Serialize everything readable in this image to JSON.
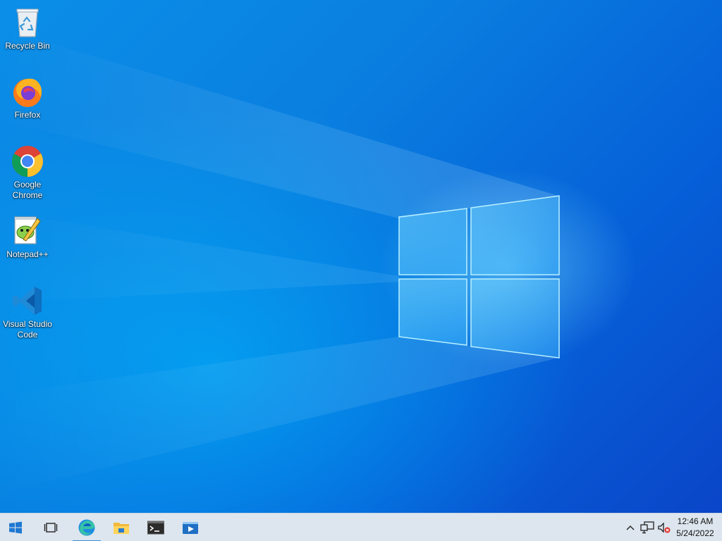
{
  "desktop": {
    "icons": [
      {
        "label": "Recycle Bin",
        "icon": "recycle-bin-icon"
      },
      {
        "label": "Firefox",
        "icon": "firefox-icon"
      },
      {
        "label": "Google Chrome",
        "icon": "chrome-icon"
      },
      {
        "label": "Notepad++",
        "icon": "notepadpp-icon"
      },
      {
        "label": "Visual Studio Code",
        "icon": "vscode-icon"
      }
    ]
  },
  "taskbar": {
    "start_icon": "windows-start-icon",
    "task_view_icon": "task-view-icon",
    "pinned": [
      {
        "icon": "edge-icon",
        "active": true
      },
      {
        "icon": "file-explorer-icon",
        "active": false
      },
      {
        "icon": "terminal-icon",
        "active": false
      },
      {
        "icon": "media-player-icon",
        "active": false
      }
    ],
    "tray": {
      "icons": [
        "chevron-up-icon",
        "network-icon",
        "volume-muted-icon"
      ],
      "time": "12:46 AM",
      "date": "5/24/2022"
    }
  },
  "colors": {
    "accent": "#3a8fd6",
    "taskbar": "#dde6ee",
    "wallpaper_blue": "#0a7fe0"
  }
}
